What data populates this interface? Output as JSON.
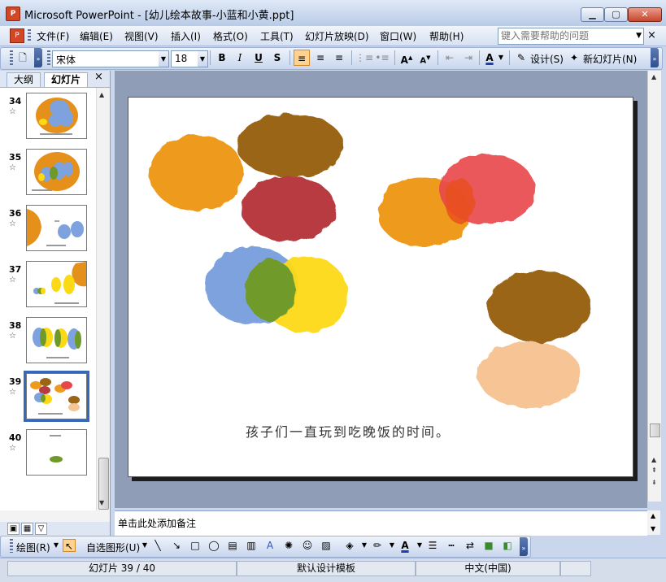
{
  "window": {
    "title": "Microsoft PowerPoint - [幼儿绘本故事-小蓝和小黄.ppt]"
  },
  "menu": {
    "items": [
      "文件(F)",
      "编辑(E)",
      "视图(V)",
      "插入(I)",
      "格式(O)",
      "工具(T)",
      "幻灯片放映(D)",
      "窗口(W)",
      "帮助(H)"
    ],
    "help_placeholder": "键入需要帮助的问题",
    "close_symbol": "×"
  },
  "toolbar": {
    "font_name": "宋体",
    "font_size": "18",
    "bold": "B",
    "italic": "I",
    "underline": "U",
    "shadow": "S",
    "design_label": "设计(S)",
    "new_slide_label": "新幻灯片(N)"
  },
  "left_pane": {
    "tabs": [
      "大纲",
      "幻灯片"
    ],
    "close_symbol": "×",
    "thumbnails": [
      {
        "number": "34",
        "selected": false
      },
      {
        "number": "35",
        "selected": false
      },
      {
        "number": "36",
        "selected": false
      },
      {
        "number": "37",
        "selected": false
      },
      {
        "number": "38",
        "selected": false
      },
      {
        "number": "39",
        "selected": true
      },
      {
        "number": "40",
        "selected": false
      }
    ]
  },
  "slide": {
    "caption": "孩子们一直玩到吃晚饭的时间。",
    "colors": {
      "orange": "#ee9a1e",
      "brown": "#9a6514",
      "crimson": "#b83a43",
      "red": "#e8474a",
      "blue": "#7da2de",
      "yellow": "#fcd915",
      "green": "#6f9a2a",
      "peach": "#f7c495"
    }
  },
  "notes": {
    "placeholder": "单击此处添加备注"
  },
  "drawing_toolbar": {
    "draw_label": "绘图(R)",
    "autoshapes_label": "自选图形(U)"
  },
  "status": {
    "slide_position": "幻灯片 39 / 40",
    "design_template": "默认设计模板",
    "language": "中文(中国)"
  }
}
